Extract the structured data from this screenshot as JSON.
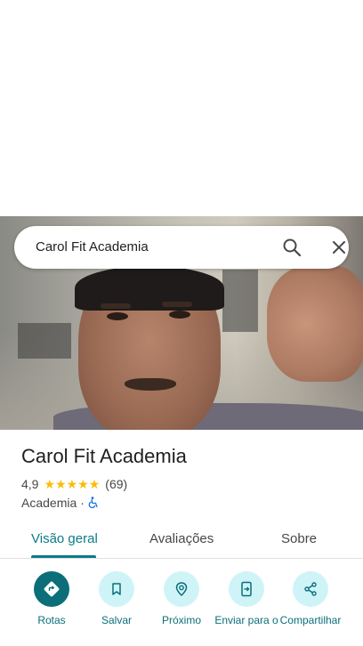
{
  "search": {
    "query": "Carol Fit Academia"
  },
  "place": {
    "title": "Carol Fit Academia",
    "rating": "4,9",
    "stars": 5,
    "review_count": "(69)",
    "category": "Academia",
    "separator": "·"
  },
  "tabs": [
    {
      "label": "Visão geral",
      "active": true
    },
    {
      "label": "Avaliações",
      "active": false
    },
    {
      "label": "Sobre",
      "active": false
    }
  ],
  "actions": [
    {
      "label": "Rotas",
      "icon": "directions-icon"
    },
    {
      "label": "Salvar",
      "icon": "bookmark-icon"
    },
    {
      "label": "Próximo",
      "icon": "nearby-icon"
    },
    {
      "label": "Enviar para o",
      "icon": "send-to-phone-icon"
    },
    {
      "label": "Compartilhar",
      "icon": "share-icon"
    }
  ],
  "colors": {
    "accent": "#0b7b88",
    "action_bg": "#cff4f8",
    "star": "#fbbc04"
  }
}
